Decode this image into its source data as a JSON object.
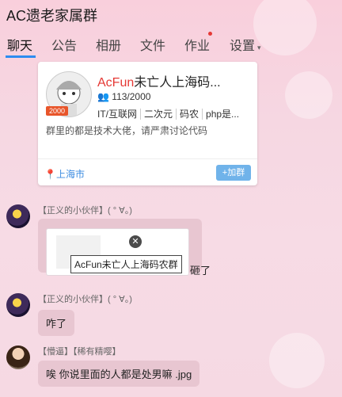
{
  "window": {
    "title": "AC遗老家属群"
  },
  "tabs": [
    {
      "label": "聊天",
      "active": true
    },
    {
      "label": "公告"
    },
    {
      "label": "相册"
    },
    {
      "label": "文件"
    },
    {
      "label": "作业",
      "has_unread_dot": true
    },
    {
      "label": "设置"
    }
  ],
  "group_card": {
    "name_brand": "AcFun",
    "name_rest": "未亡人上海码...",
    "member_count": "113/2000",
    "badge": "2000",
    "tags": [
      "IT/互联网",
      "二次元",
      "码农",
      "php是..."
    ],
    "description": "群里的都是技术大佬，请严肃讨论代码",
    "location": "上海市",
    "join_label": "+加群"
  },
  "messages": [
    {
      "sender": "【正义的小伙伴】( ° ∀。)",
      "share_tooltip": "AcFun未亡人上海码农群",
      "share_caption": "砸了"
    },
    {
      "sender": "【正义的小伙伴】( ° ∀。)",
      "text": "咋了"
    },
    {
      "sender": "【懵逼】【稀有精嘤】",
      "text": "唉 你说里面的人都是处男嘛 .jpg"
    }
  ],
  "colors": {
    "accent": "#2d8cf0",
    "brand_red": "#e53935",
    "badge_orange": "#e8552a",
    "bubble": "#e8c6d1"
  }
}
